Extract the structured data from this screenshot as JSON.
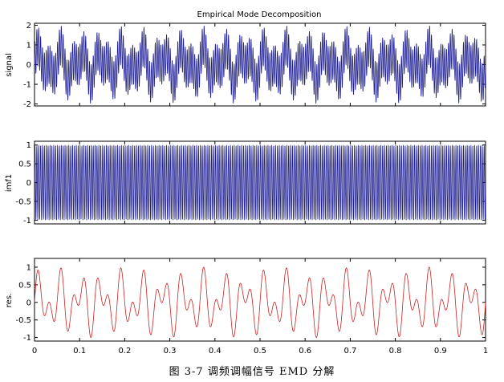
{
  "caption": "图 3-7 调频调幅信号 EMD 分解",
  "chart_data": [
    {
      "type": "line",
      "title": "Empirical Mode Decomposition",
      "ylabel": "signal",
      "xlim": [
        0,
        1
      ],
      "ylim": [
        -2.1,
        2.1
      ],
      "yticks": [
        "-2",
        "-1",
        "0",
        "1",
        "2"
      ],
      "grid": false,
      "series": [
        {
          "color": "#1f1f8f",
          "formula": "y = sin(2π·240·x) + cos(2π·8·x)·sin(2π·30·x)",
          "x_range": [
            0,
            1
          ]
        }
      ]
    },
    {
      "type": "line",
      "title": "",
      "ylabel": "imf1",
      "xlim": [
        0,
        1
      ],
      "ylim": [
        -1.1,
        1.1
      ],
      "yticks": [
        "-1",
        "-0.5",
        "0",
        "0.5",
        "1"
      ],
      "grid": false,
      "series": [
        {
          "color": "#1f1f8f",
          "formula": "y = sin(2π·240·x)",
          "x_range": [
            0,
            1
          ]
        }
      ]
    },
    {
      "type": "line",
      "title": "",
      "ylabel": "res.",
      "xlabel": "",
      "xlim": [
        0,
        1
      ],
      "ylim": [
        -1.1,
        1.25
      ],
      "yticks": [
        "-1",
        "-0.5",
        "0",
        "0.5",
        "1"
      ],
      "xticks": [
        "0",
        "0.1",
        "0.2",
        "0.3",
        "0.4",
        "0.5",
        "0.6",
        "0.7",
        "0.8",
        "0.9",
        "1"
      ],
      "grid": false,
      "series": [
        {
          "color": "#cc2020",
          "formula": "y = cos(2π·8·x)·sin(2π·30·x)",
          "x_range": [
            0,
            1
          ]
        }
      ]
    }
  ]
}
